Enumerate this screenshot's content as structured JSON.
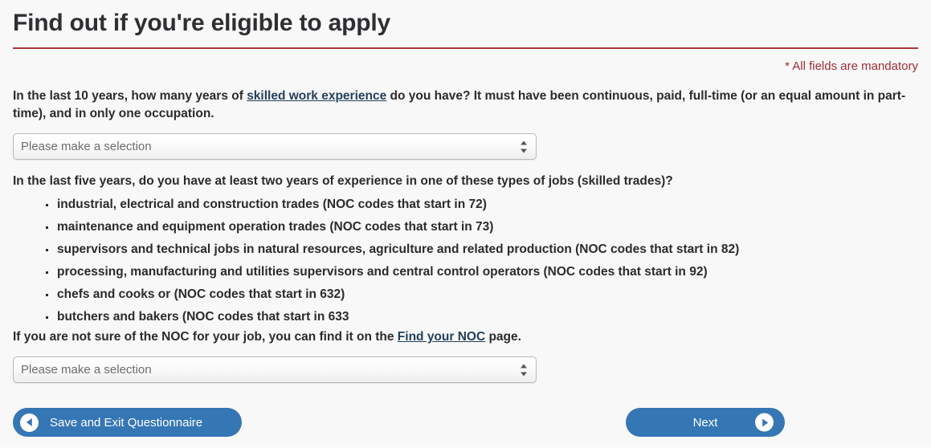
{
  "header": {
    "title": "Find out if you're eligible to apply",
    "mandatory_note": "* All fields are mandatory",
    "rule_color": "#a8383b",
    "note_color": "#9d2b35"
  },
  "question1": {
    "text_before_link": "In the last 10 years, how many years of ",
    "link_text": "skilled work experience",
    "text_after_link": " do you have? It must have been continuous, paid, full-time (or an equal amount in part-time), and in only one occupation.",
    "select": {
      "value": "Please make a selection",
      "arrow_icon": "updown-arrows-icon"
    }
  },
  "question2": {
    "text": "In the last five years, do you have at least two years of experience in one of these types of jobs (skilled trades)?",
    "bullets": [
      "industrial, electrical and construction trades (NOC codes that start in 72)",
      "maintenance and equipment operation trades (NOC codes that start in 73)",
      "supervisors and technical jobs in natural resources, agriculture and related production (NOC codes that start in 82)",
      "processing, manufacturing and utilities supervisors and central control operators (NOC codes that start in 92)",
      "chefs and cooks or (NOC codes that start in 632)",
      "butchers and bakers (NOC codes that start in 633"
    ],
    "noc_help_before": "If you are not sure of the NOC for your job, you can find it on the ",
    "noc_link_text": "Find your NOC",
    "noc_help_after": " page.",
    "select": {
      "value": "Please make a selection",
      "arrow_icon": "updown-arrows-icon"
    }
  },
  "footer": {
    "save_button_label": "Save and Exit Questionnaire",
    "save_button_icon": "arrow-left-circle-icon",
    "next_button_label": "Next",
    "next_button_icon": "arrow-right-circle-icon",
    "button_color": "#3576b5"
  }
}
